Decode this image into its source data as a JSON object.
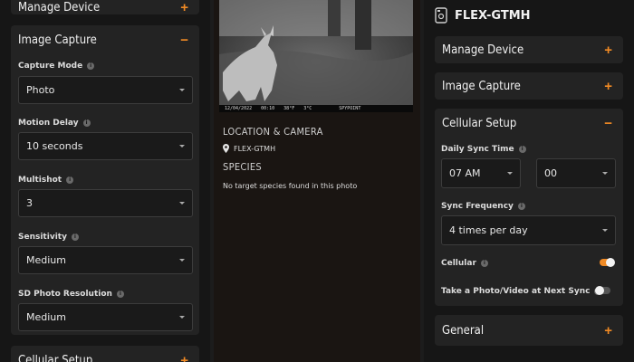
{
  "left": {
    "manage_device": "Manage Device",
    "image_capture": "Image Capture",
    "capture_mode": {
      "label": "Capture Mode",
      "value": "Photo"
    },
    "motion_delay": {
      "label": "Motion Delay",
      "value": "10 seconds"
    },
    "multishot": {
      "label": "Multishot",
      "value": "3"
    },
    "sensitivity": {
      "label": "Sensitivity",
      "value": "Medium"
    },
    "sd_resolution": {
      "label": "SD Photo Resolution",
      "value": "Medium"
    },
    "cellular_setup": "Cellular Setup"
  },
  "middle": {
    "photo_strip": {
      "date": "12/04/2022",
      "time": "00:10",
      "temp_f": "38°F",
      "temp_c": "3°C",
      "brand": "SPYPOINT"
    },
    "location_title": "LOCATION & CAMERA",
    "location_name": "FLEX-GTMH",
    "species_title": "SPECIES",
    "species_text": "No target species found in this photo"
  },
  "right": {
    "device_name": "FLEX-GTMH",
    "manage_device": "Manage Device",
    "image_capture": "Image Capture",
    "cellular_setup": "Cellular Setup",
    "daily_sync": {
      "label": "Daily Sync Time",
      "hour": "07 AM",
      "minute": "00"
    },
    "sync_frequency": {
      "label": "Sync Frequency",
      "value": "4 times per day"
    },
    "cellular": {
      "label": "Cellular",
      "on": true
    },
    "take_photo": {
      "label": "Take a Photo/Video at Next Sync",
      "on": false
    },
    "general": "General"
  },
  "colors": {
    "accent": "#f08a24",
    "card": "#232323",
    "field": "#1a1a1a"
  },
  "icons": [
    "plus-icon",
    "minus-icon",
    "info-icon",
    "caret-down-icon",
    "location-pin-icon",
    "camera-device-icon"
  ]
}
